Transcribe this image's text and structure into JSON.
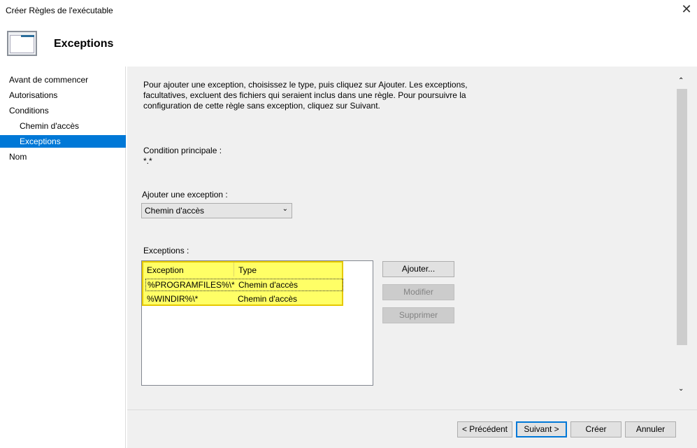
{
  "window": {
    "title": "Créer Règles de l'exécutable",
    "close_icon": "close-icon"
  },
  "header": {
    "title": "Exceptions"
  },
  "sidebar": {
    "items": [
      {
        "label": "Avant de commencer"
      },
      {
        "label": "Autorisations"
      },
      {
        "label": "Conditions"
      },
      {
        "label": "Chemin d'accès"
      },
      {
        "label": "Exceptions"
      },
      {
        "label": "Nom"
      }
    ]
  },
  "main": {
    "intro": [
      "Pour ajouter une exception, choisissez le type, puis cliquez sur Ajouter.  Les exceptions,",
      "facultatives, excluent des fichiers qui seraient inclus dans une règle. Pour poursuivre la",
      "configuration de cette règle sans exception, cliquez sur Suivant."
    ],
    "condition_label": "Condition principale :",
    "condition_value": "*.*",
    "add_label": "Ajouter une exception :",
    "add_select": "Chemin d'accès",
    "list_label": "Exceptions :",
    "columns": [
      "Exception",
      "Type"
    ],
    "rows": [
      {
        "exception": "%PROGRAMFILES%\\*",
        "type": "Chemin d'accès"
      },
      {
        "exception": "%WINDIR%\\*",
        "type": "Chemin d'accès"
      }
    ],
    "buttons": {
      "add": "Ajouter...",
      "modify": "Modifier",
      "delete": "Supprimer"
    }
  },
  "footer": {
    "prev": "< Précédent",
    "next": "Suivant >",
    "create": "Créer",
    "cancel": "Annuler"
  }
}
